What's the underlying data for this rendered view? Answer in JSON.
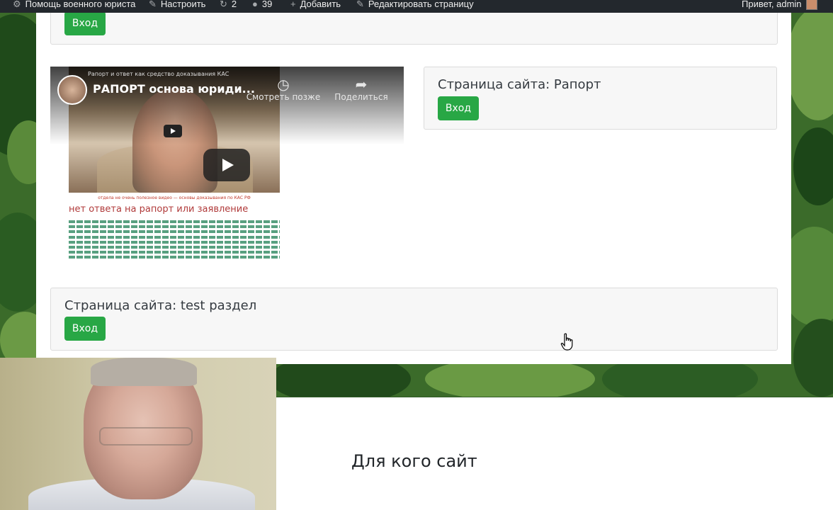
{
  "adminbar": {
    "site": "Помощь военного юриста",
    "customize": "Настроить",
    "updates": "2",
    "comments": "39",
    "add": "Добавить",
    "edit": "Редактировать страницу",
    "greeting": "Привет, admin"
  },
  "cards": [
    {
      "title": "",
      "button": "Вход"
    },
    {
      "title": "Страница сайта: Рапорт",
      "button": "Вход"
    },
    {
      "title": "Страница сайта: test раздел",
      "button": "Вход"
    }
  ],
  "video": {
    "channel_title": "Рапорт и ответ как средство доказывания КАС",
    "title": "РАПОРТ основа юриди...",
    "watch_later": "Смотреть позже",
    "share": "Поделиться",
    "small_watch_later": "Смотреть позже",
    "small_share": "Поделит",
    "caption": "отдела не очень полезное видео — основы доказывания по КАС РФ",
    "red_heading": "нет ответа на рапорт или заявление"
  },
  "lower": {
    "title": "Для кого сайт"
  },
  "colors": {
    "accent_green": "#28a745",
    "adminbar": "#23282d"
  }
}
